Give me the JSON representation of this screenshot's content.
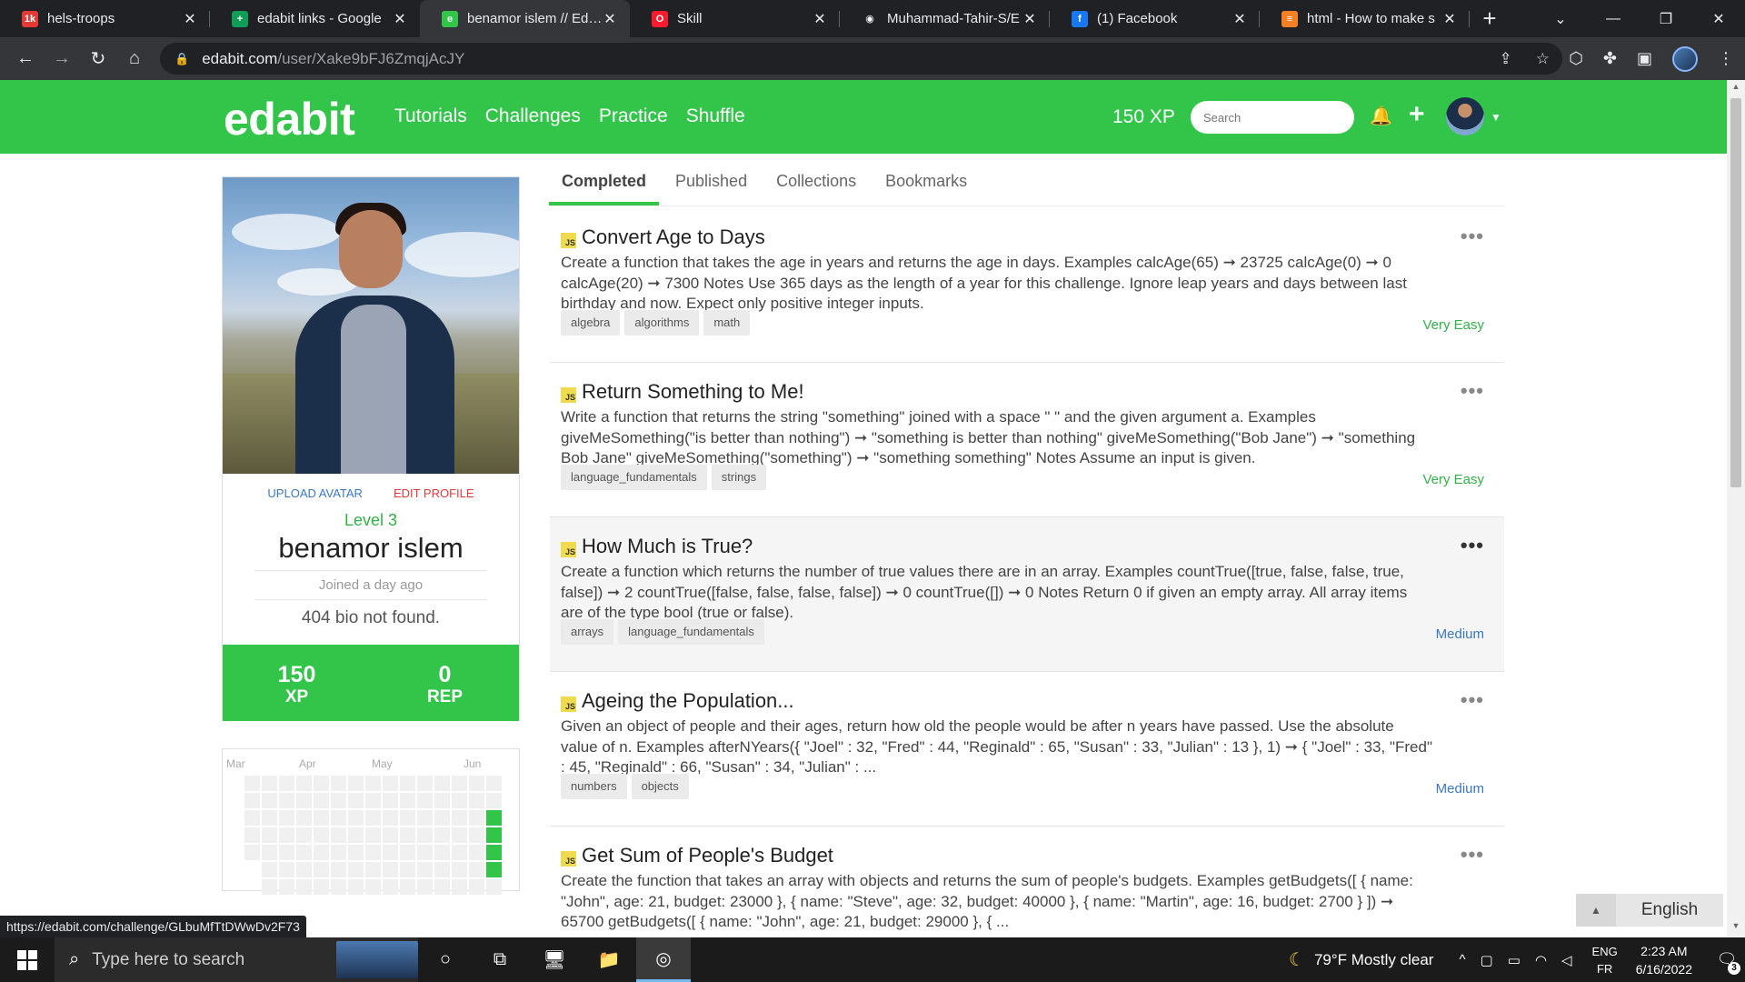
{
  "browser": {
    "tabs": [
      {
        "title": "hels-troops",
        "icon": "1k-icon",
        "color": "#e53935",
        "glyph": "1k"
      },
      {
        "title": "edabit links - Google",
        "icon": "sheets-icon",
        "color": "#0f9d58",
        "glyph": "+"
      },
      {
        "title": "benamor islem // Edabit",
        "icon": "edabit-icon",
        "color": "#33c54a",
        "glyph": "e",
        "active": true
      },
      {
        "title": "Skill",
        "icon": "opera-icon",
        "color": "#ff1b2d",
        "glyph": "O"
      },
      {
        "title": "Muhammad-Tahir-S/E",
        "icon": "github-icon",
        "color": "#202124",
        "glyph": "◉"
      },
      {
        "title": "(1) Facebook",
        "icon": "facebook-icon",
        "color": "#1877f2",
        "glyph": "f"
      },
      {
        "title": "html - How to make s",
        "icon": "stackoverflow-icon",
        "color": "#f48024",
        "glyph": "≡"
      }
    ],
    "url_host": "edabit.com",
    "url_path": "/user/Xake9bFJ6ZmqjAcJY",
    "status_url": "https://edabit.com/challenge/GLbuMfTtDWwDv2F73"
  },
  "site": {
    "logo": "edabit",
    "nav": [
      "Tutorials",
      "Challenges",
      "Practice",
      "Shuffle"
    ],
    "xp": "150 XP",
    "search_placeholder": "Search",
    "brand_color": "#33c54a"
  },
  "profile": {
    "upload_avatar": "UPLOAD AVATAR",
    "edit_profile": "EDIT PROFILE",
    "level": "Level 3",
    "name": "benamor islem",
    "joined": "Joined a day ago",
    "bio": "404 bio not found.",
    "xp_value": "150",
    "xp_label": "XP",
    "rep_value": "0",
    "rep_label": "REP"
  },
  "activity": {
    "months": [
      "Mar",
      "Apr",
      "May",
      "Jun"
    ]
  },
  "tabs": [
    "Completed",
    "Published",
    "Collections",
    "Bookmarks"
  ],
  "challenges": [
    {
      "lang": "JS",
      "title": "Convert Age to Days",
      "desc": "Create a function that takes the age in years and returns the age in days. Examples calcAge(65) ➞ 23725 calcAge(0) ➞ 0 calcAge(20) ➞ 7300 Notes Use 365 days as the length of a year for this challenge. Ignore leap years and days between last birthday and now. Expect only positive integer inputs.",
      "tags": [
        "algebra",
        "algorithms",
        "math"
      ],
      "difficulty": "Very Easy"
    },
    {
      "lang": "JS",
      "title": "Return Something to Me!",
      "desc": "Write a function that returns the string \"something\" joined with a space \" \" and the given argument a. Examples giveMeSomething(\"is better than nothing\") ➞ \"something is better than nothing\" giveMeSomething(\"Bob Jane\") ➞ \"something Bob Jane\" giveMeSomething(\"something\") ➞ \"something something\" Notes Assume an input is given.",
      "tags": [
        "language_fundamentals",
        "strings"
      ],
      "difficulty": "Very Easy"
    },
    {
      "lang": "JS",
      "title": "How Much is True?",
      "desc": "Create a function which returns the number of true values there are in an array. Examples countTrue([true, false, false, true, false]) ➞ 2 countTrue([false, false, false, false]) ➞ 0 countTrue([]) ➞ 0 Notes Return 0 if given an empty array. All array items are of the type bool (true or false).",
      "tags": [
        "arrays",
        "language_fundamentals"
      ],
      "difficulty": "Medium"
    },
    {
      "lang": "JS",
      "title": "Ageing the Population...",
      "desc": "Given an object of people and their ages, return how old the people would be after n years have passed. Use the absolute value of n. Examples afterNYears({ \"Joel\" : 32, \"Fred\" : 44, \"Reginald\" : 65, \"Susan\" : 33, \"Julian\" : 13 }, 1) ➞ { \"Joel\" : 33, \"Fred\" : 45, \"Reginald\" : 66, \"Susan\" : 34, \"Julian\" : ...",
      "tags": [
        "numbers",
        "objects"
      ],
      "difficulty": "Medium"
    },
    {
      "lang": "JS",
      "title": "Get Sum of People's Budget",
      "desc": "Create the function that takes an array with objects and returns the sum of people's budgets. Examples getBudgets([ { name: \"John\", age: 21, budget: 23000 }, { name: \"Steve\", age: 32, budget: 40000 }, { name: \"Martin\", age: 16, budget: 2700 } ]) ➞ 65700 getBudgets([ { name: \"John\", age: 21, budget: 29000 }, { ...",
      "tags": [],
      "difficulty": ""
    }
  ],
  "language_widget": "English",
  "taskbar": {
    "search": "Type here to search",
    "weather": "79°F  Mostly clear",
    "lang_line1": "ENG",
    "lang_line2": "FR",
    "time": "2:23 AM",
    "date": "6/16/2022",
    "notif_count": "3"
  }
}
